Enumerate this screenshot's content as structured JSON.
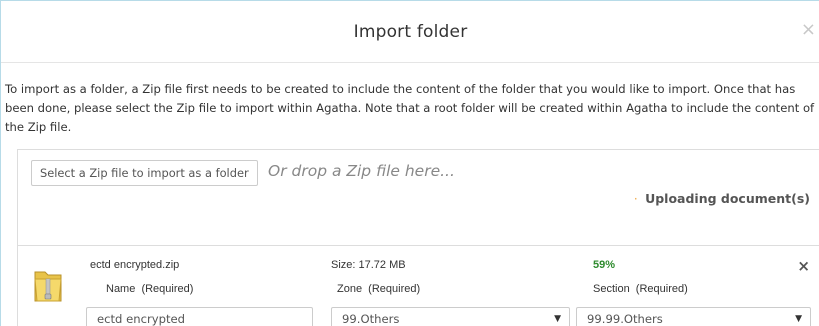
{
  "dialog": {
    "title": "Import folder",
    "close_label": "×",
    "intro_text": "To import as a folder, a Zip file first needs to be created to include the content of the folder that you would like to import. Once that has been done, please select the Zip file to import within Agatha. Note that a root folder will be created within Agatha to include the content of the Zip file."
  },
  "upload": {
    "select_button_label": "Select a Zip file to import as a folder",
    "drop_text": "Or drop a Zip file here...",
    "status_bullet": "·",
    "status_text": "Uploading document(s)"
  },
  "file": {
    "icon": "zip-folder-icon",
    "filename": "ectd encrypted.zip",
    "size_text": "Size: 17.72 MB",
    "progress_text": "59%",
    "progress_value": 0.59,
    "remove_label": "×",
    "name_label": "Name  (Required)",
    "zone_label": "Zone  (Required)",
    "section_label": "Section  (Required)",
    "name_value": "ectd encrypted",
    "zone_value": "99.Others",
    "section_value": "99.99.Others",
    "select_arrow": "▼"
  },
  "colors": {
    "progress": "#2e8b2e",
    "status_bullet": "#f0ad4e",
    "border": "#dddddd"
  }
}
